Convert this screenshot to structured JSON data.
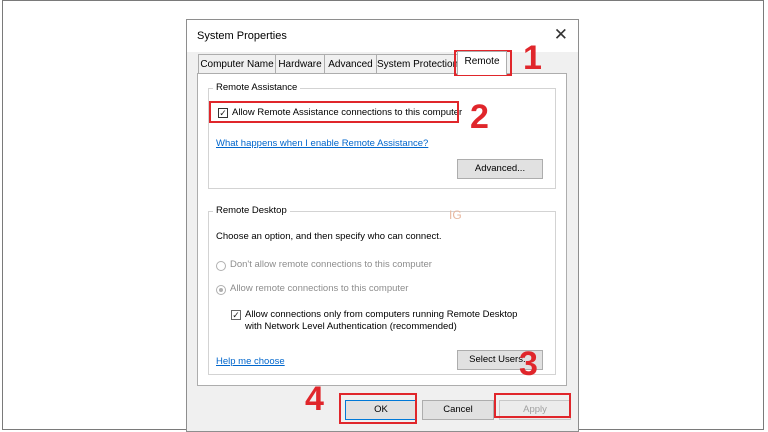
{
  "dialog": {
    "title": "System Properties",
    "close_glyph": "✕",
    "tabs": [
      {
        "label": "Computer Name"
      },
      {
        "label": "Hardware"
      },
      {
        "label": "Advanced"
      },
      {
        "label": "System Protection"
      },
      {
        "label": "Remote"
      }
    ],
    "active_tab": "Remote"
  },
  "remote_assistance": {
    "legend": "Remote Assistance",
    "allow_label": "Allow Remote Assistance connections to this computer",
    "allow_checked": true,
    "help_link": "What happens when I enable Remote Assistance?",
    "advanced_button": "Advanced..."
  },
  "remote_desktop": {
    "legend": "Remote Desktop",
    "instruction": "Choose an option, and then specify who can connect.",
    "option_dont_allow": "Don't allow remote connections to this computer",
    "option_allow": "Allow remote connections to this computer",
    "selected_option": "allow",
    "nla_label_line1": "Allow connections only from computers running Remote Desktop",
    "nla_label_line2": "with Network Level Authentication (recommended)",
    "nla_checked": true,
    "help_link": "Help me choose",
    "select_users_button": "Select Users..."
  },
  "footer": {
    "ok_button": "OK",
    "cancel_button": "Cancel",
    "apply_button": "Apply",
    "apply_enabled": false
  },
  "annotations": {
    "step1": "1",
    "step2": "2",
    "step3": "3",
    "step4": "4",
    "color": "#e0262b"
  },
  "watermark": "IG"
}
